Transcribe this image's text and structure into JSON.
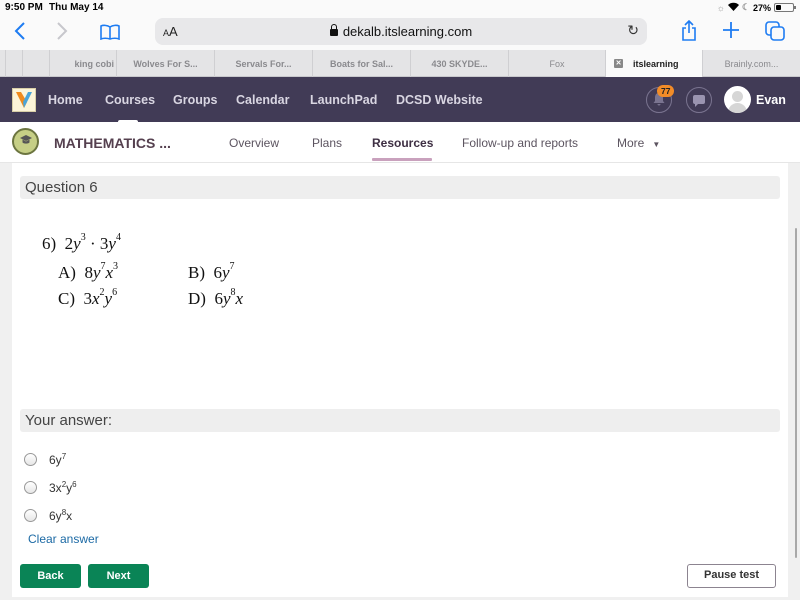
{
  "status_bar": {
    "time": "9:50 PM",
    "date": "Thu May 14",
    "battery": "27%"
  },
  "browser": {
    "text_size_label": "AA",
    "url": "dekalb.itslearning.com",
    "icons": [
      "back-icon",
      "forward-icon",
      "bookmarks-icon",
      "lock-icon",
      "reload-icon",
      "share-icon",
      "new-tab-icon",
      "tabs-icon"
    ],
    "tabs": [
      {
        "label": ""
      },
      {
        "label": ""
      },
      {
        "label": "king cobi"
      },
      {
        "label": "Wolves For S..."
      },
      {
        "label": "Servals For..."
      },
      {
        "label": "Boats for Sal..."
      },
      {
        "label": "430 SKYDE..."
      },
      {
        "label": "Fox"
      },
      {
        "label": "itslearning",
        "active": true
      },
      {
        "label": "Brainly.com..."
      }
    ]
  },
  "topnav": {
    "items": [
      "Home",
      "Courses",
      "Groups",
      "Calendar",
      "LaunchPad",
      "DCSD Website"
    ],
    "notification_count": "77",
    "user_name": "Evan"
  },
  "course_nav": {
    "course_title": "MATHEMATICS ...",
    "items": [
      "Overview",
      "Plans",
      "Resources",
      "Follow-up and reports",
      "More"
    ],
    "active_item": "Resources"
  },
  "question": {
    "heading": "Question 6",
    "problem": {
      "number": "6)",
      "expression": "2y³ · 3y⁴",
      "options": [
        {
          "letter": "A)",
          "text": "8y⁷x³"
        },
        {
          "letter": "B)",
          "text": "6y⁷"
        },
        {
          "letter": "C)",
          "text": "3x²y⁶"
        },
        {
          "letter": "D)",
          "text": "6y⁸x"
        }
      ]
    }
  },
  "answer": {
    "heading": "Your answer:",
    "choices": [
      {
        "base": "6y",
        "sup1": "7",
        "mid": "",
        "sup2": "",
        "tail": "",
        "selected": false
      },
      {
        "base": "3x",
        "sup1": "2",
        "mid": "y",
        "sup2": "6",
        "tail": "",
        "selected": false
      },
      {
        "base": "6y",
        "sup1": "8",
        "mid": "x",
        "sup2": "",
        "tail": "",
        "selected": false
      }
    ],
    "clear_label": "Clear answer"
  },
  "footer": {
    "back_label": "Back",
    "next_label": "Next",
    "pause_label": "Pause test"
  },
  "colors": {
    "nav_bg": "#413b56",
    "accent_green": "#0a8456",
    "badge_orange": "#f28c28",
    "link_blue": "#1c6aa5",
    "safari_blue": "#1e7cf2"
  }
}
